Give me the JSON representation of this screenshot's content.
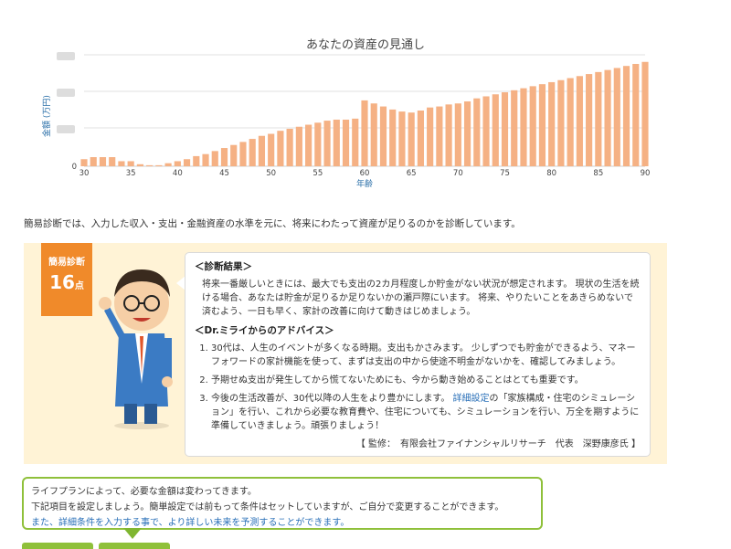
{
  "chart_data": {
    "type": "bar",
    "title": "あなたの資産の見通し",
    "xlabel": "年齢",
    "ylabel": "金額 (万円)",
    "x_tick_labels": [
      "30",
      "35",
      "40",
      "45",
      "50",
      "55",
      "60",
      "65",
      "70",
      "75",
      "80",
      "85",
      "90"
    ],
    "y_tick_labels": [
      "0"
    ],
    "ages": [
      30,
      31,
      32,
      33,
      34,
      35,
      36,
      37,
      38,
      39,
      40,
      41,
      42,
      43,
      44,
      45,
      46,
      47,
      48,
      49,
      50,
      51,
      52,
      53,
      54,
      55,
      56,
      57,
      58,
      59,
      60,
      61,
      62,
      63,
      64,
      65,
      66,
      67,
      68,
      69,
      70,
      71,
      72,
      73,
      74,
      75,
      76,
      77,
      78,
      79,
      80,
      81,
      82,
      83,
      84,
      85,
      86,
      87,
      88,
      89,
      90
    ],
    "values": [
      0.7,
      0.9,
      0.9,
      0.9,
      0.5,
      0.5,
      0.2,
      0.1,
      0.1,
      0.3,
      0.5,
      0.7,
      1.0,
      1.2,
      1.5,
      1.8,
      2.1,
      2.4,
      2.7,
      3.0,
      3.2,
      3.5,
      3.7,
      3.9,
      4.1,
      4.3,
      4.5,
      4.6,
      4.6,
      4.7,
      6.5,
      6.2,
      5.9,
      5.6,
      5.4,
      5.3,
      5.5,
      5.8,
      5.9,
      6.1,
      6.2,
      6.4,
      6.7,
      6.9,
      7.1,
      7.3,
      7.5,
      7.7,
      7.9,
      8.1,
      8.3,
      8.5,
      8.7,
      8.9,
      9.1,
      9.3,
      9.5,
      9.7,
      9.9,
      10.1,
      10.3
    ],
    "ylim": [
      0,
      11
    ],
    "grid": true,
    "colors": {
      "bar": "#f5b184",
      "grid": "#e2e2e2"
    }
  },
  "intro_text": "簡易診断では、入力した収入・支出・金融資産の水準を元に、将来にわたって資産が足りるのかを診断しています。",
  "badge": {
    "label": "簡易診断",
    "score": "16",
    "unit": "点"
  },
  "result": {
    "heading1": "＜診断結果＞",
    "body1": "将来一番厳しいときには、最大でも支出の2カ月程度しか貯金がない状況が想定されます。 現状の生活を続ける場合、あなたは貯金が足りるか足りないかの瀬戸際にいます。 将来、やりたいことをあきらめないで済むよう、一日も早く、家計の改善に向けて動きはじめましょう。",
    "heading2": "＜Dr.ミライからのアドバイス＞",
    "advice1": "30代は、人生のイベントが多くなる時期。支出もかさみます。 少しずつでも貯金ができるよう、マネーフォワードの家計機能を使って、まずは支出の中から使途不明金がないかを、確認してみましょう。",
    "advice2": "予期せぬ支出が発生してから慌てないためにも、今から動き始めることはとても重要です。",
    "advice3_a": "今後の生活改善が、30代以降の人生をより豊かにします。",
    "advice3_link": "詳細設定",
    "advice3_b": "の「家族構成・住宅のシミュレーション」を行い、これから必要な教育費や、住宅についても、シミュレーションを行い、万全を期すように準備していきましょう。頑張りましょう！",
    "signature": "【 監修：　有限会社ファイナンシャルリサーチ　代表　深野康彦氏 】"
  },
  "lifeplan": {
    "line1": "ライフプランによって、必要な金額は変わってきます。",
    "line2": "下記項目を設定しましょう。簡単設定では前もって条件はセットしていますが、ご自分で変更することができます。",
    "line3": "また、詳細条件を入力する事で、より詳しい未来を予測することができます。"
  }
}
